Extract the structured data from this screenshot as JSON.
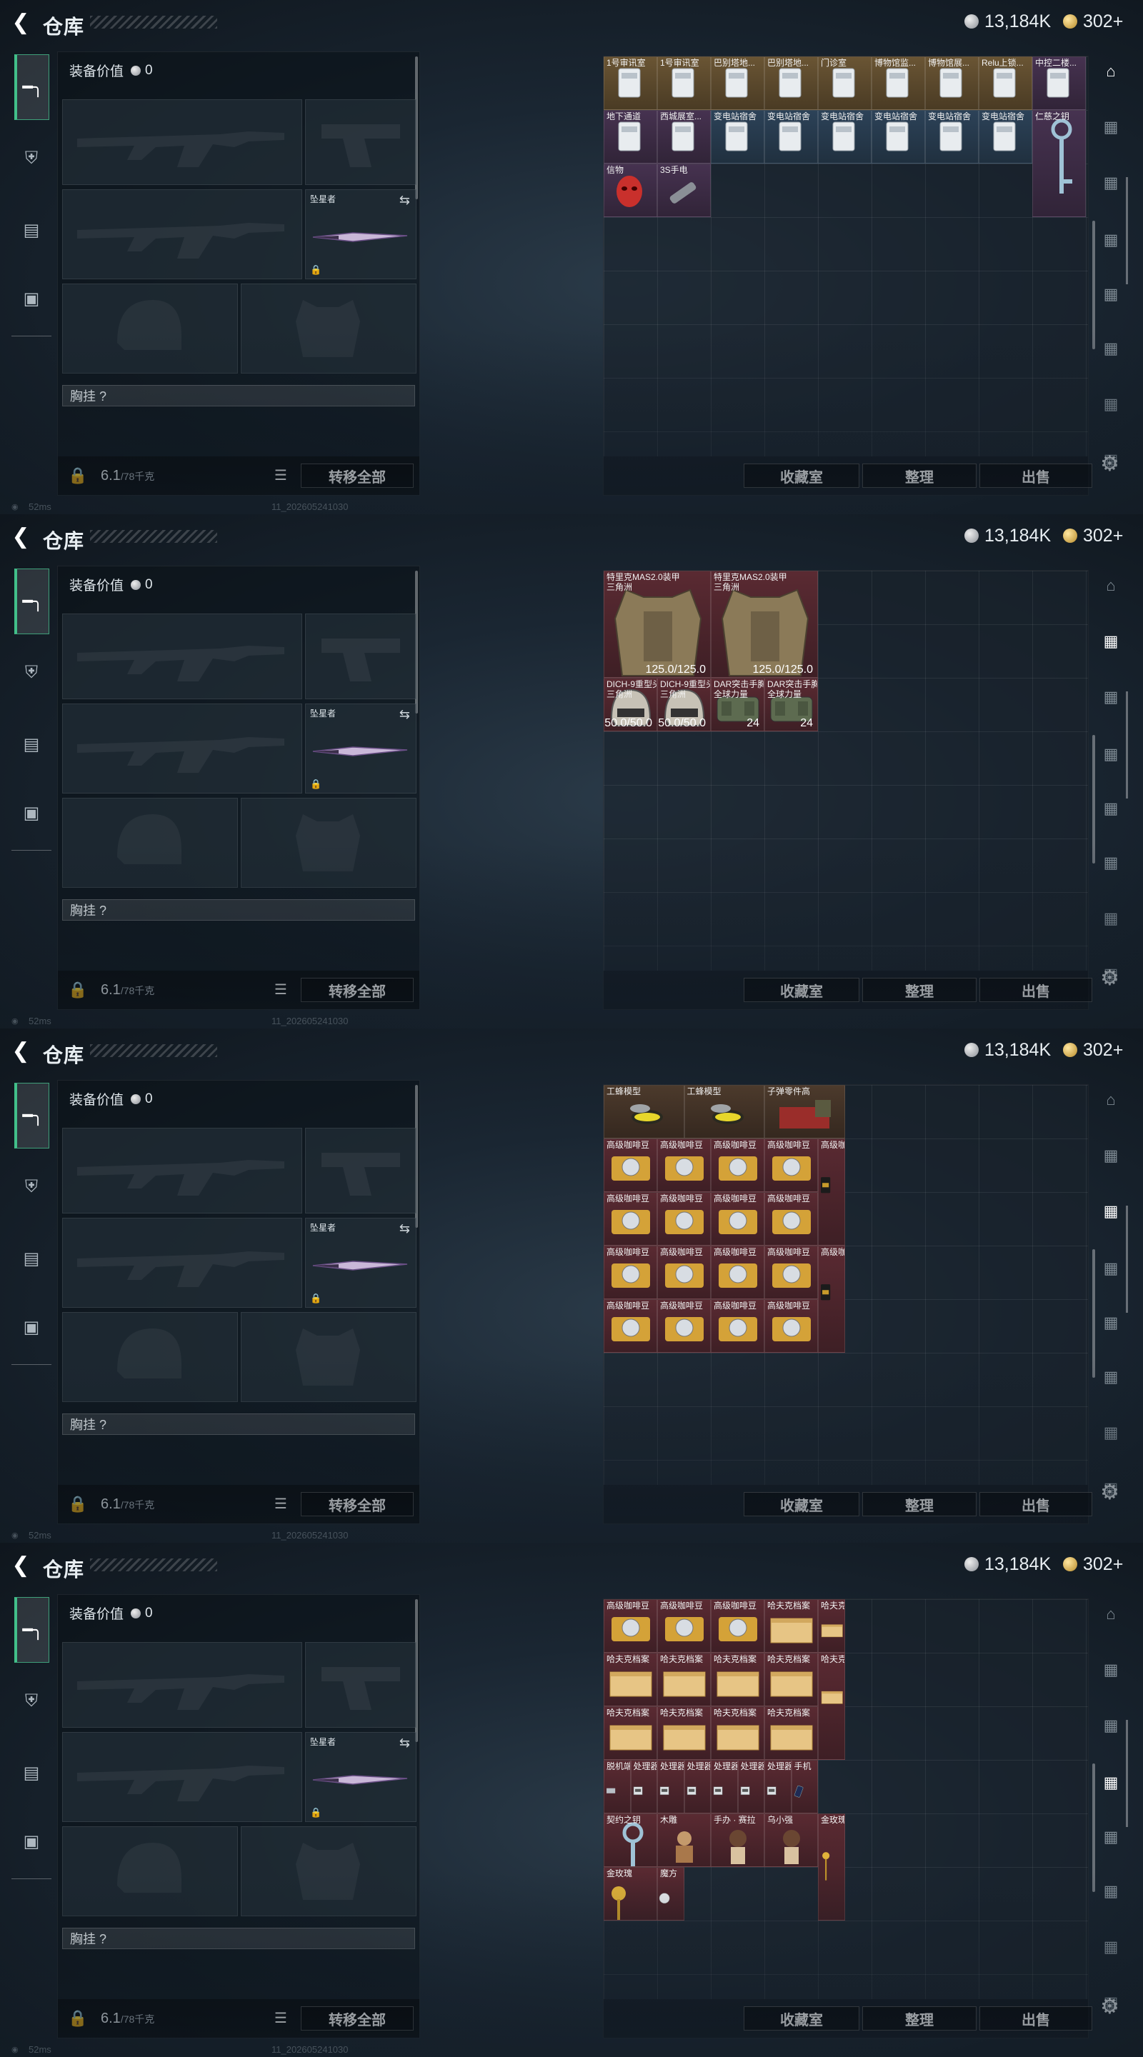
{
  "screens": [
    {
      "id": "s1",
      "active_tab": 0
    },
    {
      "id": "s2",
      "active_tab": 1
    },
    {
      "id": "s3",
      "active_tab": 2
    },
    {
      "id": "s4",
      "active_tab": 3
    }
  ],
  "header": {
    "title": "仓库",
    "currency_silver": "13,184K",
    "currency_gold": "302+"
  },
  "equipment": {
    "value_label": "装备价值",
    "value": "0",
    "melee_label": "坠星者",
    "chest_label": "胸挂 ?",
    "weight": "6.1",
    "weight_max": "/78千克",
    "transfer_all": "转移全部"
  },
  "stash_actions": {
    "collection": "收藏室",
    "sort": "整理",
    "sell": "出售"
  },
  "status": {
    "ping": "52ms",
    "build": "11_202605241030"
  },
  "icons": {
    "back": "back-arrow-icon",
    "settings": "gear-icon",
    "lock": "lock-icon",
    "list": "list-icon",
    "swap": "swap-icon"
  },
  "stash_pages": [
    {
      "items": [
        {
          "name": "1号审讯室",
          "rarity": "gold",
          "c": 0,
          "r": 0,
          "w": 1,
          "h": 1,
          "icon": "keycard"
        },
        {
          "name": "1号审讯室",
          "rarity": "gold",
          "c": 1,
          "r": 0,
          "w": 1,
          "h": 1,
          "icon": "keycard"
        },
        {
          "name": "巴别塔地...",
          "rarity": "gold",
          "c": 2,
          "r": 0,
          "w": 1,
          "h": 1,
          "icon": "keycard"
        },
        {
          "name": "巴别塔地...",
          "rarity": "gold",
          "c": 3,
          "r": 0,
          "w": 1,
          "h": 1,
          "icon": "keycard"
        },
        {
          "name": "门诊室",
          "rarity": "gold",
          "c": 4,
          "r": 0,
          "w": 1,
          "h": 1,
          "icon": "keycard"
        },
        {
          "name": "博物馆监...",
          "rarity": "gold",
          "c": 5,
          "r": 0,
          "w": 1,
          "h": 1,
          "icon": "keycard"
        },
        {
          "name": "博物馆展...",
          "rarity": "gold",
          "c": 6,
          "r": 0,
          "w": 1,
          "h": 1,
          "icon": "keycard"
        },
        {
          "name": "Relu上锁...",
          "rarity": "gold",
          "c": 7,
          "r": 0,
          "w": 1,
          "h": 1,
          "icon": "keycard"
        },
        {
          "name": "中控二楼...",
          "rarity": "purple",
          "c": 8,
          "r": 0,
          "w": 1,
          "h": 1,
          "icon": "keycard"
        },
        {
          "name": "地下通道",
          "rarity": "purple",
          "c": 0,
          "r": 1,
          "w": 1,
          "h": 1,
          "icon": "keycard"
        },
        {
          "name": "西城展室...",
          "rarity": "purple",
          "c": 1,
          "r": 1,
          "w": 1,
          "h": 1,
          "icon": "keycard"
        },
        {
          "name": "变电站宿舍",
          "rarity": "blue",
          "c": 2,
          "r": 1,
          "w": 1,
          "h": 1,
          "icon": "keycard"
        },
        {
          "name": "变电站宿舍",
          "rarity": "blue",
          "c": 3,
          "r": 1,
          "w": 1,
          "h": 1,
          "icon": "keycard"
        },
        {
          "name": "变电站宿舍",
          "rarity": "blue",
          "c": 4,
          "r": 1,
          "w": 1,
          "h": 1,
          "icon": "keycard"
        },
        {
          "name": "变电站宿舍",
          "rarity": "blue",
          "c": 5,
          "r": 1,
          "w": 1,
          "h": 1,
          "icon": "keycard"
        },
        {
          "name": "变电站宿舍",
          "rarity": "blue",
          "c": 6,
          "r": 1,
          "w": 1,
          "h": 1,
          "icon": "keycard"
        },
        {
          "name": "变电站宿舍",
          "rarity": "blue",
          "c": 7,
          "r": 1,
          "w": 1,
          "h": 1,
          "icon": "keycard"
        },
        {
          "name": "仁慈之钥",
          "rarity": "purple",
          "c": 8,
          "r": 1,
          "w": 1,
          "h": 2,
          "icon": "key"
        },
        {
          "name": "信物",
          "rarity": "purple",
          "c": 0,
          "r": 2,
          "w": 1,
          "h": 1,
          "icon": "mask"
        },
        {
          "name": "3S手电",
          "rarity": "purple",
          "c": 1,
          "r": 2,
          "w": 1,
          "h": 1,
          "icon": "flashlight"
        }
      ]
    },
    {
      "items": [
        {
          "name": "特里克MAS2.0装甲\n三角洲",
          "rarity": "red",
          "c": 0,
          "r": 0,
          "w": 2,
          "h": 2,
          "icon": "armor",
          "stat": "125.0/125.0"
        },
        {
          "name": "特里克MAS2.0装甲\n三角洲",
          "rarity": "red",
          "c": 2,
          "r": 0,
          "w": 2,
          "h": 2,
          "icon": "armor",
          "stat": "125.0/125.0"
        },
        {
          "name": "DICH-9重型头盔\n三角洲",
          "rarity": "red",
          "c": 0,
          "r": 2,
          "w": 1,
          "h": 1,
          "icon": "helmet",
          "stat": "50.0/50.0"
        },
        {
          "name": "DICH-9重型头盔\n三角洲",
          "rarity": "red",
          "c": 1,
          "r": 2,
          "w": 1,
          "h": 1,
          "icon": "helmet",
          "stat": "50.0/50.0"
        },
        {
          "name": "DAR突击手胸挂\n全球力量",
          "rarity": "red",
          "c": 2,
          "r": 2,
          "w": 1,
          "h": 1,
          "icon": "rig",
          "stat": "24"
        },
        {
          "name": "DAR突击手胸挂\n全球力量",
          "rarity": "red",
          "c": 3,
          "r": 2,
          "w": 1,
          "h": 1,
          "icon": "rig",
          "stat": "24"
        }
      ]
    },
    {
      "items": [
        {
          "name": "工蜂模型",
          "rarity": "brown",
          "c": 0,
          "r": 0,
          "w": 1.5,
          "h": 1,
          "icon": "wasp"
        },
        {
          "name": "工蜂模型",
          "rarity": "brown",
          "c": 1.5,
          "r": 0,
          "w": 1.5,
          "h": 1,
          "icon": "wasp"
        },
        {
          "name": "子弹零件高",
          "rarity": "brown",
          "c": 3,
          "r": 0,
          "w": 1.5,
          "h": 1,
          "icon": "parts"
        },
        {
          "name": "高级咖啡豆",
          "rarity": "red",
          "c": 0,
          "r": 1,
          "w": 1,
          "h": 1,
          "icon": "coffee"
        },
        {
          "name": "高级咖啡豆",
          "rarity": "red",
          "c": 1,
          "r": 1,
          "w": 1,
          "h": 1,
          "icon": "coffee"
        },
        {
          "name": "高级咖啡豆",
          "rarity": "red",
          "c": 2,
          "r": 1,
          "w": 1,
          "h": 1,
          "icon": "coffee"
        },
        {
          "name": "高级咖啡豆",
          "rarity": "red",
          "c": 3,
          "r": 1,
          "w": 1,
          "h": 1,
          "icon": "coffee"
        },
        {
          "name": "高级咖啡豆",
          "rarity": "red",
          "c": 4,
          "r": 1,
          "w": 0.5,
          "h": 2,
          "icon": "coffeebag"
        },
        {
          "name": "高级咖啡豆",
          "rarity": "red",
          "c": 0,
          "r": 2,
          "w": 1,
          "h": 1,
          "icon": "coffee"
        },
        {
          "name": "高级咖啡豆",
          "rarity": "red",
          "c": 1,
          "r": 2,
          "w": 1,
          "h": 1,
          "icon": "coffee"
        },
        {
          "name": "高级咖啡豆",
          "rarity": "red",
          "c": 2,
          "r": 2,
          "w": 1,
          "h": 1,
          "icon": "coffee"
        },
        {
          "name": "高级咖啡豆",
          "rarity": "red",
          "c": 3,
          "r": 2,
          "w": 1,
          "h": 1,
          "icon": "coffee"
        },
        {
          "name": "高级咖啡豆",
          "rarity": "red",
          "c": 0,
          "r": 3,
          "w": 1,
          "h": 1,
          "icon": "coffee"
        },
        {
          "name": "高级咖啡豆",
          "rarity": "red",
          "c": 1,
          "r": 3,
          "w": 1,
          "h": 1,
          "icon": "coffee"
        },
        {
          "name": "高级咖啡豆",
          "rarity": "red",
          "c": 2,
          "r": 3,
          "w": 1,
          "h": 1,
          "icon": "coffee"
        },
        {
          "name": "高级咖啡豆",
          "rarity": "red",
          "c": 3,
          "r": 3,
          "w": 1,
          "h": 1,
          "icon": "coffee"
        },
        {
          "name": "高级咖啡豆",
          "rarity": "red",
          "c": 4,
          "r": 3,
          "w": 0.5,
          "h": 2,
          "icon": "coffeebag"
        },
        {
          "name": "高级咖啡豆",
          "rarity": "red",
          "c": 0,
          "r": 4,
          "w": 1,
          "h": 1,
          "icon": "coffee"
        },
        {
          "name": "高级咖啡豆",
          "rarity": "red",
          "c": 1,
          "r": 4,
          "w": 1,
          "h": 1,
          "icon": "coffee"
        },
        {
          "name": "高级咖啡豆",
          "rarity": "red",
          "c": 2,
          "r": 4,
          "w": 1,
          "h": 1,
          "icon": "coffee"
        },
        {
          "name": "高级咖啡豆",
          "rarity": "red",
          "c": 3,
          "r": 4,
          "w": 1,
          "h": 1,
          "icon": "coffee"
        }
      ]
    },
    {
      "items": [
        {
          "name": "高级咖啡豆",
          "rarity": "red",
          "c": 0,
          "r": 0,
          "w": 1,
          "h": 1,
          "icon": "coffee"
        },
        {
          "name": "高级咖啡豆",
          "rarity": "red",
          "c": 1,
          "r": 0,
          "w": 1,
          "h": 1,
          "icon": "coffee"
        },
        {
          "name": "高级咖啡豆",
          "rarity": "red",
          "c": 2,
          "r": 0,
          "w": 1,
          "h": 1,
          "icon": "coffee"
        },
        {
          "name": "哈夫克档案",
          "rarity": "red",
          "c": 3,
          "r": 0,
          "w": 1,
          "h": 1,
          "icon": "file"
        },
        {
          "name": "哈夫克档案",
          "rarity": "red",
          "c": 4,
          "r": 0,
          "w": 0.5,
          "h": 1,
          "icon": "file"
        },
        {
          "name": "哈夫克档案",
          "rarity": "red",
          "c": 0,
          "r": 1,
          "w": 1,
          "h": 1,
          "icon": "file"
        },
        {
          "name": "哈夫克档案",
          "rarity": "red",
          "c": 1,
          "r": 1,
          "w": 1,
          "h": 1,
          "icon": "file"
        },
        {
          "name": "哈夫克档案",
          "rarity": "red",
          "c": 2,
          "r": 1,
          "w": 1,
          "h": 1,
          "icon": "file"
        },
        {
          "name": "哈夫克档案",
          "rarity": "red",
          "c": 3,
          "r": 1,
          "w": 1,
          "h": 1,
          "icon": "file"
        },
        {
          "name": "哈夫克档案",
          "rarity": "red",
          "c": 0,
          "r": 2,
          "w": 1,
          "h": 1,
          "icon": "file"
        },
        {
          "name": "哈夫克档案",
          "rarity": "red",
          "c": 1,
          "r": 2,
          "w": 1,
          "h": 1,
          "icon": "file"
        },
        {
          "name": "哈夫克档案",
          "rarity": "red",
          "c": 2,
          "r": 2,
          "w": 1,
          "h": 1,
          "icon": "file"
        },
        {
          "name": "哈夫克档案",
          "rarity": "red",
          "c": 3,
          "r": 2,
          "w": 1,
          "h": 1,
          "icon": "file"
        },
        {
          "name": "哈夫克档案",
          "rarity": "red",
          "c": 4,
          "r": 1,
          "w": 0.5,
          "h": 2,
          "icon": "file"
        },
        {
          "name": "脱机端子",
          "rarity": "red",
          "c": 0,
          "r": 3,
          "w": 0.5,
          "h": 1,
          "icon": "device"
        },
        {
          "name": "处理器",
          "rarity": "red",
          "c": 0.5,
          "r": 3,
          "w": 0.5,
          "h": 1,
          "icon": "cpu"
        },
        {
          "name": "处理器",
          "rarity": "red",
          "c": 1,
          "r": 3,
          "w": 0.5,
          "h": 1,
          "icon": "cpu"
        },
        {
          "name": "处理器",
          "rarity": "red",
          "c": 1.5,
          "r": 3,
          "w": 0.5,
          "h": 1,
          "icon": "cpu"
        },
        {
          "name": "处理器",
          "rarity": "red",
          "c": 2,
          "r": 3,
          "w": 0.5,
          "h": 1,
          "icon": "cpu"
        },
        {
          "name": "处理器",
          "rarity": "red",
          "c": 2.5,
          "r": 3,
          "w": 0.5,
          "h": 1,
          "icon": "cpu"
        },
        {
          "name": "处理器",
          "rarity": "red",
          "c": 3,
          "r": 3,
          "w": 0.5,
          "h": 1,
          "icon": "cpu"
        },
        {
          "name": "手机",
          "rarity": "red",
          "c": 3.5,
          "r": 3,
          "w": 0.5,
          "h": 1,
          "icon": "phone"
        },
        {
          "name": "契约之钥",
          "rarity": "red",
          "c": 0,
          "r": 4,
          "w": 1,
          "h": 1,
          "icon": "key"
        },
        {
          "name": "木雕",
          "rarity": "red",
          "c": 1,
          "r": 4,
          "w": 1,
          "h": 1,
          "icon": "statue"
        },
        {
          "name": "手办 · 赛拉",
          "rarity": "red",
          "c": 2,
          "r": 4,
          "w": 1,
          "h": 1,
          "icon": "figure"
        },
        {
          "name": "乌小强",
          "rarity": "red",
          "c": 3,
          "r": 4,
          "w": 1,
          "h": 1,
          "icon": "figure"
        },
        {
          "name": "金玫瑰",
          "rarity": "red",
          "c": 4,
          "r": 4,
          "w": 0.5,
          "h": 2,
          "icon": "rose"
        },
        {
          "name": "金玫瑰",
          "rarity": "red",
          "c": 0,
          "r": 5,
          "w": 1,
          "h": 1,
          "icon": "rose"
        },
        {
          "name": "魔方",
          "rarity": "red",
          "c": 1,
          "r": 5,
          "w": 0.5,
          "h": 1,
          "icon": "cube"
        }
      ]
    }
  ]
}
